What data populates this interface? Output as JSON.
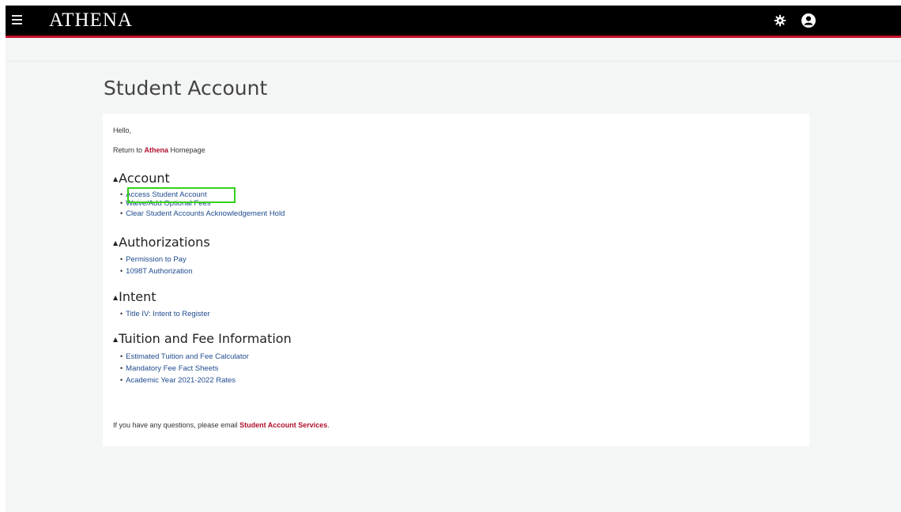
{
  "header": {
    "logo": "ATHENA",
    "icons": [
      "menu-icon",
      "gear-icon",
      "user-icon"
    ],
    "accent_color": "#c8102e"
  },
  "page": {
    "title": "Student Account"
  },
  "card": {
    "greeting": "Hello,",
    "return_prefix": "Return to ",
    "return_link": "Athena",
    "return_suffix": " Homepage",
    "sections": [
      {
        "title": "Account",
        "links": [
          "Access Student Account",
          "Waive/Add Optional Fees",
          "Clear Student Accounts Acknowledgement Hold"
        ]
      },
      {
        "title": "Authorizations",
        "links": [
          "Permission to Pay",
          "1098T Authorization"
        ]
      },
      {
        "title": "Intent",
        "links": [
          "Title IV: Intent to Register"
        ]
      },
      {
        "title": "Tuition and Fee Information",
        "links": [
          "Estimated Tuition and Fee Calculator",
          "Mandatory Fee Fact Sheets",
          "Academic Year 2021-2022 Rates"
        ]
      }
    ],
    "footer_prefix": "If you have any questions, please email ",
    "footer_link": "Student Account Services",
    "footer_suffix": "."
  },
  "colors": {
    "link": "#1f4b8e",
    "brand_red": "#b0102b",
    "highlight": "#35d11a"
  }
}
